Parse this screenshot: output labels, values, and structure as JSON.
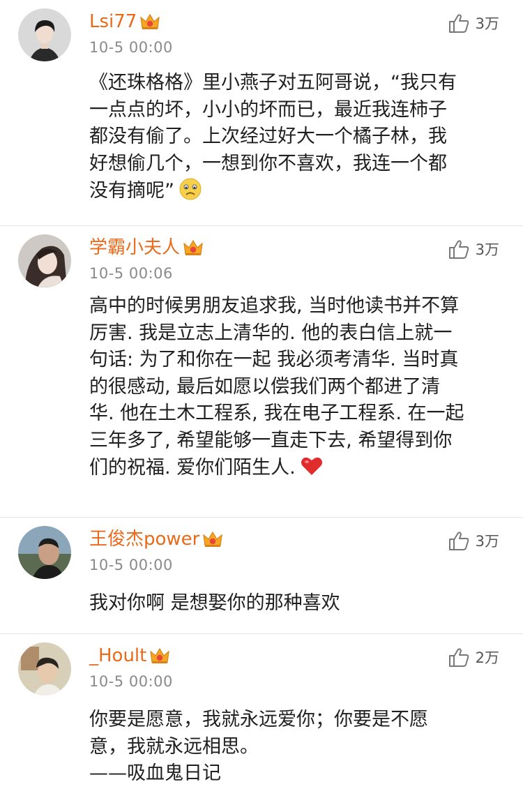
{
  "comments": [
    {
      "username": "Lsi77",
      "time": "10-5 00:00",
      "likes": "3万",
      "text": "《还珠格格》里小燕子对五阿哥说，“我只有\n一点点的坏，小小的坏而已，最近我连柿子\n都没有偷了。上次经过好大一个橘子林，我\n好想偷几个，一想到你不喜欢，我连一个都\n没有摘呢”",
      "emoji": "sad-face-emoji"
    },
    {
      "username": "学霸小夫人",
      "time": "10-5 00:06",
      "likes": "3万",
      "text": "高中的时候男朋友追求我, 当时他读书并不算\n厉害. 我是立志上清华的. 他的表白信上就一\n句话: 为了和你在一起  我必须考清华. 当时真\n的很感动, 最后如愿以偿我们两个都进了清\n华. 他在土木工程系, 我在电子工程系. 在一起\n三年多了, 希望能够一直走下去, 希望得到你\n们的祝福. 爱你们陌生人.",
      "emoji": "red-heart-emoji"
    },
    {
      "username": "王俊杰power",
      "time": "10-5 00:00",
      "likes": "3万",
      "text": "我对你啊 是想娶你的那种喜欢"
    },
    {
      "username": "_Hoult",
      "time": "10-5 00:00",
      "likes": "2万",
      "text": "你要是愿意，我就永远爱你；你要是不愿\n意，我就永远相思。\n——吸血鬼日记"
    }
  ],
  "icons": {
    "vip": "vip-crown-icon",
    "like": "thumbs-up-icon"
  },
  "colors": {
    "username": "#e86a1a",
    "timestamp": "#8a8a8a",
    "divider": "#e6e6e6"
  }
}
